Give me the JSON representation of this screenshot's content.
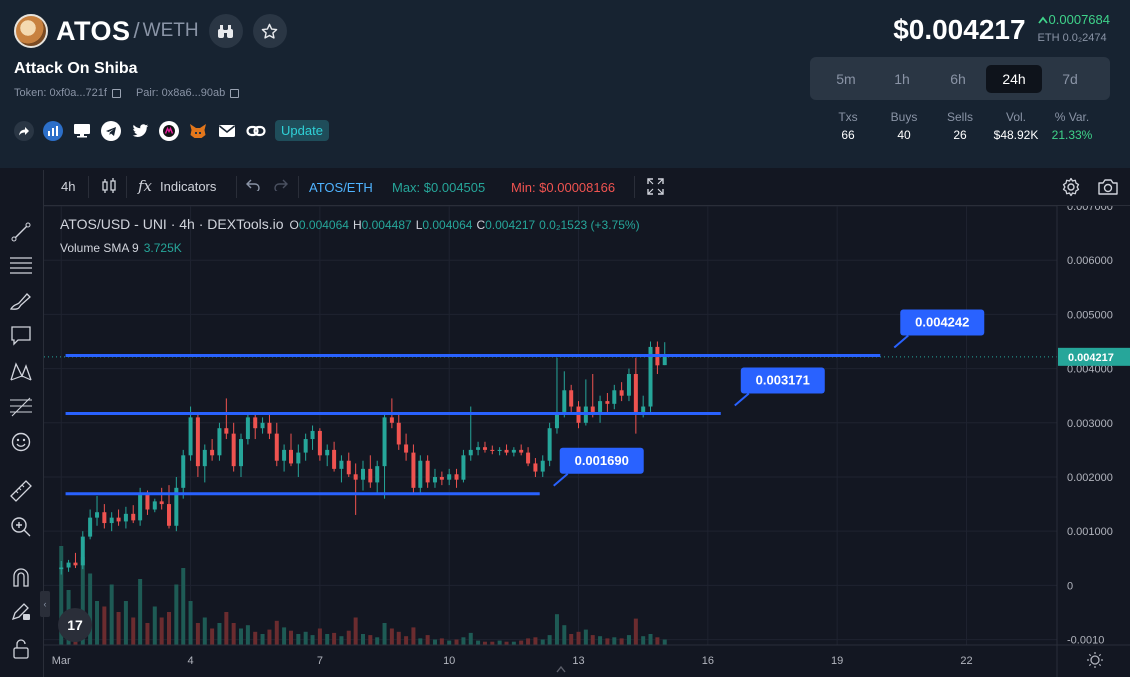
{
  "header": {
    "symbol": "ATOS",
    "slash": "/",
    "quote": "WETH",
    "token_name": "Attack On Shiba",
    "token_addr": "Token: 0xf0a...721f",
    "pair_addr": "Pair: 0x8a6...90ab",
    "update_label": "Update",
    "price": "$0.004217",
    "change": "0.0007684",
    "eth_price": "ETH 0.0₂2474",
    "timeframes": [
      "5m",
      "1h",
      "6h",
      "24h",
      "7d"
    ],
    "active_timeframe": "24h",
    "stats": [
      {
        "label": "Txs",
        "value": "66"
      },
      {
        "label": "Buys",
        "value": "40"
      },
      {
        "label": "Sells",
        "value": "26"
      },
      {
        "label": "Vol.",
        "value": "$48.92K"
      },
      {
        "label": "% Var.",
        "value": "21.33%"
      }
    ],
    "social_icons": [
      "share-icon",
      "chart-icon",
      "website-icon",
      "telegram-icon",
      "twitter-icon",
      "coin-icon",
      "metamask-icon",
      "email-icon",
      "link-icon"
    ]
  },
  "toolbar": {
    "interval": "4h",
    "indicators": "Indicators",
    "pair": "ATOS/ETH",
    "max": "Max: $0.004505",
    "min": "Min: $0.00008166"
  },
  "legend": {
    "title": "ATOS/USD - UNI · 4h · DEXTools.io",
    "o_label": "O",
    "o": "0.004064",
    "h_label": "H",
    "h": "0.004487",
    "l_label": "L",
    "l": "0.004064",
    "c_label": "C",
    "c": "0.004217",
    "chg": "0.0₂1523 (+3.75%)",
    "volume_label": "Volume SMA 9",
    "volume_value": "3.725K"
  },
  "colors": {
    "up": "#26a69a",
    "down": "#ef5350",
    "level_line": "#2962ff",
    "label_bg": "#2962ff",
    "price_tag": "#26a69a",
    "header_bg": "#172331"
  },
  "chart_data": {
    "type": "candlestick",
    "y_ticks": [
      "0.007000",
      "0.006000",
      "0.005000",
      "0.004000",
      "0.003000",
      "0.002000",
      "0.001000",
      "0",
      "-0.0010"
    ],
    "y_tick_values": [
      0.007,
      0.006,
      0.005,
      0.004,
      0.003,
      0.002,
      0.001,
      0,
      -0.001
    ],
    "x_ticks": [
      "Mar",
      "4",
      "7",
      "10",
      "13",
      "16",
      "19",
      "22"
    ],
    "x_tick_days": [
      1,
      4,
      7,
      10,
      13,
      16,
      19,
      22
    ],
    "ylim": [
      -0.0011,
      0.007
    ],
    "xlim": [
      0.6,
      24.1
    ],
    "current_price": "0.004217",
    "current_price_value": 0.004217,
    "levels": [
      {
        "label": "0.004242",
        "value": 0.004242,
        "x_start": 1.1,
        "x_end": 20.0
      },
      {
        "label": "0.003171",
        "value": 0.003171,
        "x_start": 1.1,
        "x_end": 16.3
      },
      {
        "label": "0.001690",
        "value": 0.00169,
        "x_start": 1.1,
        "x_end": 12.1
      }
    ],
    "candles": [
      [
        1.0,
        0.0003,
        0.00045,
        0.0002,
        0.00033
      ],
      [
        1.17,
        0.00033,
        0.00047,
        0.00025,
        0.00042
      ],
      [
        1.33,
        0.00042,
        0.0006,
        0.00032,
        0.00037
      ],
      [
        1.5,
        0.00037,
        0.001,
        0.0003,
        0.0009
      ],
      [
        1.67,
        0.0009,
        0.0014,
        0.00085,
        0.00125
      ],
      [
        1.83,
        0.00125,
        0.00165,
        0.0011,
        0.00135
      ],
      [
        2.0,
        0.00135,
        0.0015,
        0.00105,
        0.00115
      ],
      [
        2.17,
        0.00115,
        0.00135,
        0.001,
        0.00125
      ],
      [
        2.33,
        0.00125,
        0.0014,
        0.0011,
        0.00118
      ],
      [
        2.5,
        0.00118,
        0.00145,
        0.00105,
        0.00132
      ],
      [
        2.67,
        0.00132,
        0.00148,
        0.00115,
        0.0012
      ],
      [
        2.83,
        0.0012,
        0.0018,
        0.0011,
        0.0017
      ],
      [
        3.0,
        0.0017,
        0.00175,
        0.0013,
        0.0014
      ],
      [
        3.17,
        0.0014,
        0.0016,
        0.00135,
        0.00155
      ],
      [
        3.33,
        0.00155,
        0.0018,
        0.0014,
        0.0015
      ],
      [
        3.5,
        0.0015,
        0.00185,
        0.00105,
        0.0011
      ],
      [
        3.67,
        0.0011,
        0.002,
        0.001,
        0.0018
      ],
      [
        3.83,
        0.0018,
        0.0025,
        0.0016,
        0.0024
      ],
      [
        4.0,
        0.0024,
        0.0033,
        0.0023,
        0.0031
      ],
      [
        4.17,
        0.0031,
        0.0032,
        0.002,
        0.0022
      ],
      [
        4.33,
        0.0022,
        0.0026,
        0.0019,
        0.0025
      ],
      [
        4.5,
        0.0025,
        0.0027,
        0.0023,
        0.0024
      ],
      [
        4.67,
        0.0024,
        0.003,
        0.0023,
        0.0029
      ],
      [
        4.83,
        0.0029,
        0.00345,
        0.0027,
        0.0028
      ],
      [
        5.0,
        0.0028,
        0.003,
        0.0021,
        0.0022
      ],
      [
        5.17,
        0.0022,
        0.0028,
        0.002,
        0.0027
      ],
      [
        5.33,
        0.0027,
        0.0032,
        0.0026,
        0.0031
      ],
      [
        5.5,
        0.0031,
        0.0032,
        0.0027,
        0.0029
      ],
      [
        5.67,
        0.0029,
        0.0031,
        0.0028,
        0.003
      ],
      [
        5.83,
        0.003,
        0.00315,
        0.0027,
        0.0028
      ],
      [
        6.0,
        0.0028,
        0.003,
        0.0022,
        0.0023
      ],
      [
        6.17,
        0.0023,
        0.0026,
        0.0021,
        0.0025
      ],
      [
        6.33,
        0.0025,
        0.0028,
        0.0022,
        0.00225
      ],
      [
        6.5,
        0.00225,
        0.0026,
        0.002,
        0.00245
      ],
      [
        6.67,
        0.00245,
        0.0028,
        0.0023,
        0.0027
      ],
      [
        6.83,
        0.0027,
        0.00295,
        0.0025,
        0.00285
      ],
      [
        7.0,
        0.00285,
        0.0029,
        0.0023,
        0.0024
      ],
      [
        7.17,
        0.0024,
        0.0026,
        0.0022,
        0.0025
      ],
      [
        7.33,
        0.0025,
        0.00265,
        0.0021,
        0.00215
      ],
      [
        7.5,
        0.00215,
        0.0024,
        0.0019,
        0.0023
      ],
      [
        7.67,
        0.0023,
        0.00245,
        0.002,
        0.00205
      ],
      [
        7.83,
        0.00205,
        0.00225,
        0.0013,
        0.00195
      ],
      [
        8.0,
        0.00195,
        0.0023,
        0.00175,
        0.00215
      ],
      [
        8.17,
        0.00215,
        0.0024,
        0.0018,
        0.0019
      ],
      [
        8.33,
        0.0019,
        0.0023,
        0.0017,
        0.0022
      ],
      [
        8.5,
        0.0022,
        0.0032,
        0.0016,
        0.0031
      ],
      [
        8.67,
        0.0031,
        0.00345,
        0.0029,
        0.003
      ],
      [
        8.83,
        0.003,
        0.0032,
        0.0025,
        0.0026
      ],
      [
        9.0,
        0.0026,
        0.0028,
        0.0023,
        0.00245
      ],
      [
        9.17,
        0.00245,
        0.0026,
        0.0017,
        0.0018
      ],
      [
        9.33,
        0.0018,
        0.0024,
        0.0017,
        0.0023
      ],
      [
        9.5,
        0.0023,
        0.0024,
        0.0018,
        0.0019
      ],
      [
        9.67,
        0.0019,
        0.00215,
        0.0018,
        0.002
      ],
      [
        9.83,
        0.002,
        0.0021,
        0.00185,
        0.00195
      ],
      [
        10.0,
        0.00195,
        0.00215,
        0.00185,
        0.00205
      ],
      [
        10.17,
        0.00205,
        0.00215,
        0.0018,
        0.00195
      ],
      [
        10.33,
        0.00195,
        0.0025,
        0.0019,
        0.0024
      ],
      [
        10.5,
        0.0024,
        0.0033,
        0.0023,
        0.0025
      ],
      [
        10.67,
        0.0025,
        0.00265,
        0.0024,
        0.00255
      ],
      [
        10.83,
        0.00255,
        0.00265,
        0.00245,
        0.0025
      ],
      [
        11.0,
        0.0025,
        0.00258,
        0.00242,
        0.00248
      ],
      [
        11.17,
        0.00248,
        0.00255,
        0.0024,
        0.0025
      ],
      [
        11.33,
        0.0025,
        0.0026,
        0.0024,
        0.00245
      ],
      [
        11.5,
        0.00245,
        0.00255,
        0.00238,
        0.0025
      ],
      [
        11.67,
        0.0025,
        0.0026,
        0.0024,
        0.00245
      ],
      [
        11.83,
        0.00245,
        0.00255,
        0.0022,
        0.00225
      ],
      [
        12.0,
        0.00225,
        0.00235,
        0.002,
        0.0021
      ],
      [
        12.17,
        0.0021,
        0.0024,
        0.002,
        0.0023
      ],
      [
        12.33,
        0.0023,
        0.003,
        0.0022,
        0.0029
      ],
      [
        12.5,
        0.0029,
        0.0042,
        0.0028,
        0.0032
      ],
      [
        12.67,
        0.0032,
        0.00395,
        0.0031,
        0.0036
      ],
      [
        12.83,
        0.0036,
        0.0037,
        0.0032,
        0.0033
      ],
      [
        13.0,
        0.0033,
        0.0034,
        0.0029,
        0.003
      ],
      [
        13.17,
        0.003,
        0.0038,
        0.00295,
        0.0033
      ],
      [
        13.33,
        0.0033,
        0.0039,
        0.0031,
        0.0032
      ],
      [
        13.5,
        0.0032,
        0.0035,
        0.003,
        0.0034
      ],
      [
        13.67,
        0.0034,
        0.00355,
        0.0032,
        0.00335
      ],
      [
        13.83,
        0.00335,
        0.0037,
        0.00325,
        0.0036
      ],
      [
        14.0,
        0.0036,
        0.00375,
        0.0034,
        0.0035
      ],
      [
        14.17,
        0.0035,
        0.004,
        0.0034,
        0.0039
      ],
      [
        14.33,
        0.0039,
        0.0042,
        0.0028,
        0.0032
      ],
      [
        14.5,
        0.0032,
        0.0035,
        0.0031,
        0.0033
      ],
      [
        14.67,
        0.0033,
        0.0045,
        0.0032,
        0.0044
      ],
      [
        14.83,
        0.0044,
        0.0045,
        0.0039,
        0.00406
      ],
      [
        15.0,
        0.004064,
        0.004487,
        0.004064,
        0.004217
      ]
    ],
    "volumes": [
      [
        1.0,
        9.0
      ],
      [
        1.17,
        5.0
      ],
      [
        1.33,
        2.0
      ],
      [
        1.5,
        8.0
      ],
      [
        1.67,
        6.5
      ],
      [
        1.83,
        4.0
      ],
      [
        2.0,
        3.5
      ],
      [
        2.17,
        5.5
      ],
      [
        2.33,
        3.0
      ],
      [
        2.5,
        4.0
      ],
      [
        2.67,
        2.5
      ],
      [
        2.83,
        6.0
      ],
      [
        3.0,
        2.0
      ],
      [
        3.17,
        3.5
      ],
      [
        3.33,
        2.5
      ],
      [
        3.5,
        3.0
      ],
      [
        3.67,
        5.5
      ],
      [
        3.83,
        7.0
      ],
      [
        4.0,
        4.0
      ],
      [
        4.17,
        2.0
      ],
      [
        4.33,
        2.5
      ],
      [
        4.5,
        1.5
      ],
      [
        4.67,
        2.0
      ],
      [
        4.83,
        3.0
      ],
      [
        5.0,
        2.0
      ],
      [
        5.17,
        1.5
      ],
      [
        5.33,
        1.8
      ],
      [
        5.5,
        1.2
      ],
      [
        5.67,
        1.0
      ],
      [
        5.83,
        1.4
      ],
      [
        6.0,
        2.2
      ],
      [
        6.17,
        1.6
      ],
      [
        6.33,
        1.3
      ],
      [
        6.5,
        1.0
      ],
      [
        6.67,
        1.2
      ],
      [
        6.83,
        0.9
      ],
      [
        7.0,
        1.5
      ],
      [
        7.17,
        1.0
      ],
      [
        7.33,
        1.1
      ],
      [
        7.5,
        0.8
      ],
      [
        7.67,
        1.3
      ],
      [
        7.83,
        2.5
      ],
      [
        8.0,
        1.0
      ],
      [
        8.17,
        0.9
      ],
      [
        8.33,
        0.7
      ],
      [
        8.5,
        2.0
      ],
      [
        8.67,
        1.5
      ],
      [
        8.83,
        1.2
      ],
      [
        9.0,
        0.8
      ],
      [
        9.17,
        1.6
      ],
      [
        9.33,
        0.6
      ],
      [
        9.5,
        0.9
      ],
      [
        9.67,
        0.5
      ],
      [
        9.83,
        0.6
      ],
      [
        10.0,
        0.4
      ],
      [
        10.17,
        0.5
      ],
      [
        10.33,
        0.7
      ],
      [
        10.5,
        1.1
      ],
      [
        10.67,
        0.4
      ],
      [
        10.83,
        0.3
      ],
      [
        11.0,
        0.3
      ],
      [
        11.17,
        0.4
      ],
      [
        11.33,
        0.3
      ],
      [
        11.5,
        0.3
      ],
      [
        11.67,
        0.4
      ],
      [
        11.83,
        0.6
      ],
      [
        12.0,
        0.7
      ],
      [
        12.17,
        0.5
      ],
      [
        12.33,
        0.9
      ],
      [
        12.5,
        2.8
      ],
      [
        12.67,
        1.8
      ],
      [
        12.83,
        1.0
      ],
      [
        13.0,
        1.2
      ],
      [
        13.17,
        1.4
      ],
      [
        13.33,
        0.9
      ],
      [
        13.5,
        0.8
      ],
      [
        13.67,
        0.6
      ],
      [
        13.83,
        0.7
      ],
      [
        14.0,
        0.6
      ],
      [
        14.17,
        0.9
      ],
      [
        14.33,
        2.4
      ],
      [
        14.5,
        0.8
      ],
      [
        14.67,
        1.0
      ],
      [
        14.83,
        0.7
      ],
      [
        15.0,
        0.5
      ]
    ]
  }
}
